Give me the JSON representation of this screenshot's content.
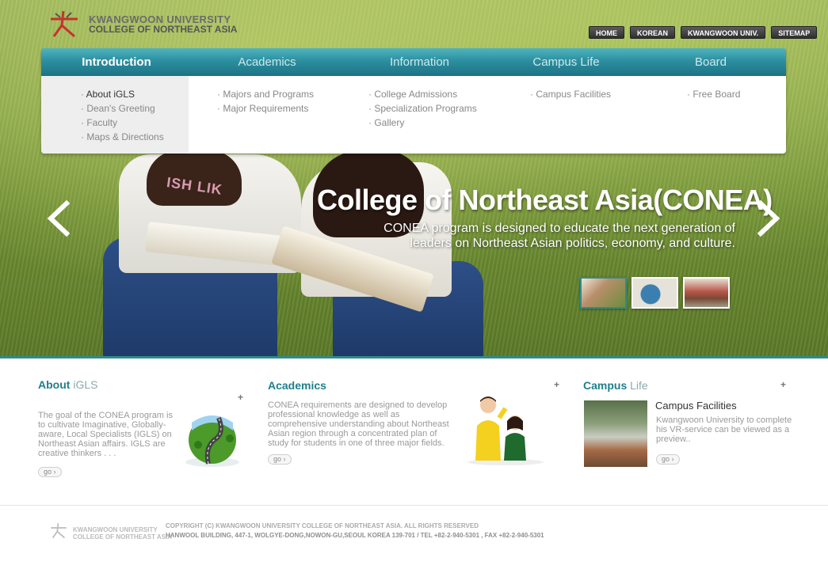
{
  "header": {
    "logo_line1": "KWANGWOON UNIVERSITY",
    "logo_line2": "COLLEGE OF NORTHEAST ASIA",
    "util_nav": [
      "HOME",
      "KOREAN",
      "KWANGWOON UNIV.",
      "SITEMAP"
    ]
  },
  "nav": {
    "items": [
      "Introduction",
      "Academics",
      "Information",
      "Campus Life",
      "Board"
    ],
    "active": "Introduction",
    "submenus": {
      "introduction": [
        "About iGLS",
        "Dean's Greeting",
        "Faculty",
        "Maps & Directions"
      ],
      "academics": [
        "Majors and Programs",
        "Major Requirements"
      ],
      "information": [
        "College Admissions",
        "Specialization Programs",
        "Gallery"
      ],
      "campus_life": [
        "Campus Facilities"
      ],
      "board": [
        "Free Board"
      ]
    },
    "active_sub": "About iGLS"
  },
  "hero": {
    "title": "College of Northeast Asia(CONEA)",
    "subtitle_line1": "CONEA program is designed to  educate the next generation of",
    "subtitle_line2": "leaders on Northeast Asian politics, economy, and culture.",
    "shirt_text": "ISH LIK",
    "active_slide": 1
  },
  "sections": {
    "about": {
      "title_bold": "About",
      "title_light": " iGLS",
      "text": "The goal of the CONEA program is to cultivate Imaginative, Globally-aware, Local Specialists (IGLS) on  Northeast Asian affairs. IGLS are creative thinkers . . .",
      "go": "go ›"
    },
    "academics": {
      "title": "Academics",
      "text": "CONEA requirements are designed to develop professional knowledge as well as comprehensive understanding about Northeast Asian region through a concentrated plan of study for students  in one of three major fields.",
      "go": "go ›"
    },
    "campus": {
      "title_bold": "Campus",
      "title_light": " Life",
      "subtitle": "Campus Facilities",
      "text": "Kwangwoon University to complete his VR-service can be viewed as a preview..",
      "go": "go ›"
    },
    "plus": "+"
  },
  "footer": {
    "logo_line1": "KWANGWOON UNIVERSITY",
    "logo_line2": "COLLEGE OF NORTHEAST ASIA",
    "copyright": "COPYRIGHT (C)  KWANGWOON UNIVERSITY COLLEGE OF NORTHEAST ASIA. ALL RIGHTS RESERVED",
    "address": "HANWOOL BUILDING, 447-1, WOLGYE-DONG,NOWON-GU,SEOUL KOREA 139-701  /  TEL +82-2-940-5301 , FAX +82-2-940-5301"
  },
  "colors": {
    "accent": "#2f8b8c",
    "nav_bar": "#2c8f9f",
    "util_button": "#3a3a3a"
  }
}
